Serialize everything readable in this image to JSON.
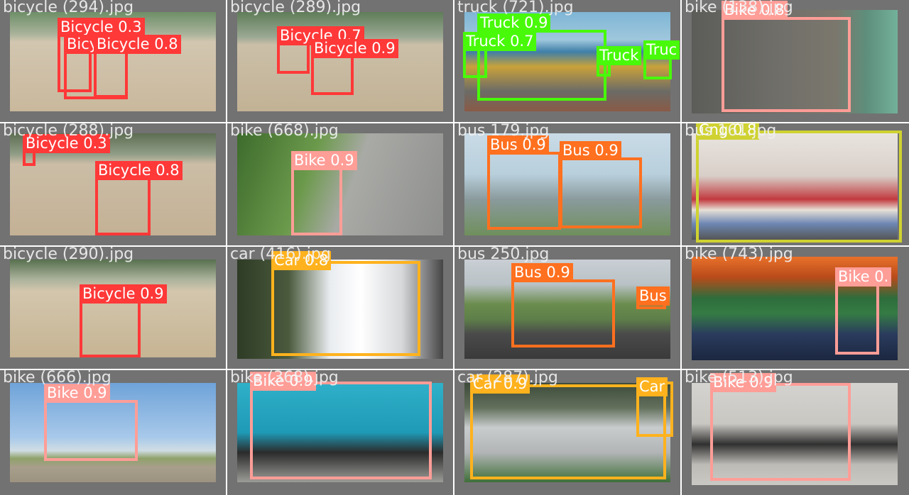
{
  "colors": {
    "bicycle": "#ff3838",
    "bike": "#ff9d97",
    "truck": "#48f90a",
    "bus": "#ff701f",
    "car": "#ffb21d",
    "cng": "#cfd231",
    "tile_bg": "#727272"
  },
  "tiles": [
    {
      "filename": "bicycle (294).jpg",
      "scene": "dirt-field",
      "detections": [
        {
          "label": "Bicycle 0.3",
          "cls": "bicycle"
        },
        {
          "label": "Bicycle 0.3",
          "cls": "bicycle"
        },
        {
          "label": "Bicycle 0.8",
          "cls": "bicycle"
        }
      ]
    },
    {
      "filename": "bicycle (289).jpg",
      "scene": "dirt-field",
      "detections": [
        {
          "label": "Bicycle 0.7",
          "cls": "bicycle"
        },
        {
          "label": "Bicycle 0.9",
          "cls": "bicycle"
        }
      ]
    },
    {
      "filename": "truck (721).jpg",
      "scene": "truck-street",
      "detections": [
        {
          "label": "Truck 0.9",
          "cls": "truck"
        },
        {
          "label": "Truck 0.7",
          "cls": "truck"
        },
        {
          "label": "Truck",
          "cls": "truck"
        },
        {
          "label": "Truc",
          "cls": "truck"
        }
      ]
    },
    {
      "filename": "bike (138).jpg",
      "scene": "garage",
      "detections": [
        {
          "label": "Bike 0.8",
          "cls": "bike"
        }
      ]
    },
    {
      "filename": "bicycle (288).jpg",
      "scene": "dirt-field",
      "detections": [
        {
          "label": "Bicycle 0.3",
          "cls": "bicycle"
        },
        {
          "label": "Bicycle 0.8",
          "cls": "bicycle"
        }
      ]
    },
    {
      "filename": "bike (668).jpg",
      "scene": "road-green",
      "detections": [
        {
          "label": "Bike 0.9",
          "cls": "bike"
        }
      ]
    },
    {
      "filename": "bus 179.jpg",
      "scene": "bus-depot",
      "detections": [
        {
          "label": "Bus 0.9",
          "cls": "bus"
        },
        {
          "label": "Bus 0.9",
          "cls": "bus"
        }
      ]
    },
    {
      "filename": "bus 161.jpg",
      "scene": "city-bus",
      "detections": [
        {
          "label": "Cng 0.8",
          "cls": "cng"
        }
      ]
    },
    {
      "filename": "bicycle (290).jpg",
      "scene": "dirt-field",
      "detections": [
        {
          "label": "Bicycle 0.9",
          "cls": "bicycle"
        }
      ]
    },
    {
      "filename": "car (416).jpg",
      "scene": "white-car",
      "detections": [
        {
          "label": "Car 0.8",
          "cls": "car"
        }
      ]
    },
    {
      "filename": "bus 250.jpg",
      "scene": "highway",
      "detections": [
        {
          "label": "Bus 0.9",
          "cls": "bus"
        },
        {
          "label": "Bus",
          "cls": "bus"
        }
      ]
    },
    {
      "filename": "bike (743).jpg",
      "scene": "forest-road",
      "detections": [
        {
          "label": "Bike 0.",
          "cls": "bike"
        }
      ]
    },
    {
      "filename": "bike (666).jpg",
      "scene": "sky",
      "detections": [
        {
          "label": "Bike 0.9",
          "cls": "bike"
        }
      ]
    },
    {
      "filename": "bike (368).jpg",
      "scene": "blue-wall",
      "detections": [
        {
          "label": "Bike 0.9",
          "cls": "bike"
        }
      ]
    },
    {
      "filename": "car (287).jpg",
      "scene": "wagon",
      "detections": [
        {
          "label": "Car 0.9",
          "cls": "car"
        },
        {
          "label": "Car",
          "cls": "car"
        }
      ]
    },
    {
      "filename": "bike (513).jpg",
      "scene": "street-bike",
      "detections": [
        {
          "label": "Bike 0.9",
          "cls": "bike"
        }
      ]
    }
  ]
}
